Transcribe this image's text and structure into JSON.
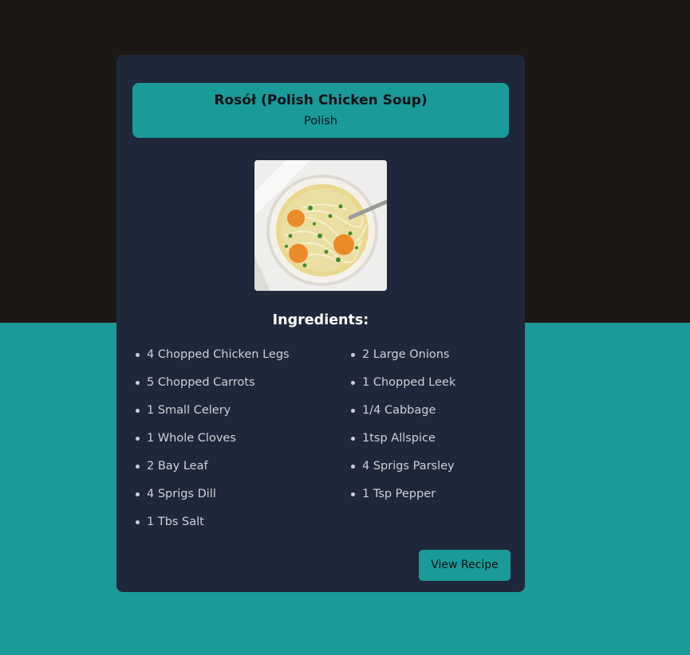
{
  "colors": {
    "background_top": "#1c1816",
    "background_bottom": "#1a9a99",
    "card": "#1f273a",
    "accent": "#1a9a99",
    "ingredient_text": "#cdd0d6"
  },
  "recipe": {
    "title": "Rosół (Polish Chicken Soup)",
    "cuisine": "Polish",
    "ingredients_heading": "Ingredients:",
    "ingredients_left": [
      "4 Chopped Chicken Legs",
      "5 Chopped Carrots",
      "1 Small Celery",
      "1 Whole Cloves",
      "2 Bay Leaf",
      "4 Sprigs Dill",
      "1 Tbs Salt"
    ],
    "ingredients_right": [
      "2 Large Onions",
      "1 Chopped Leek",
      "1/4 Cabbage",
      "1tsp Allspice",
      "4 Sprigs Parsley",
      "1 Tsp Pepper"
    ],
    "view_button_label": "View Recipe"
  }
}
